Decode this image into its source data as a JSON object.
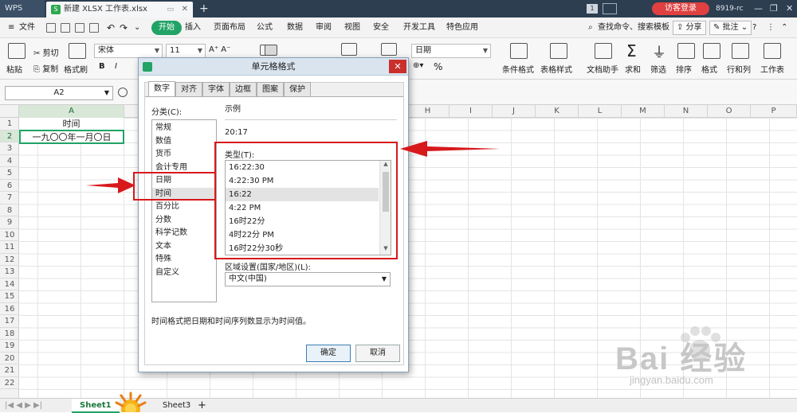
{
  "titlebar": {
    "app": "WPS",
    "file_tab": "新建 XLSX 工作表.xlsx",
    "new_tab": "+",
    "badge": "1",
    "login": "访客登录",
    "user": "8919-rc"
  },
  "menubar": {
    "file": "文件",
    "start": "开始",
    "items": [
      "插入",
      "页面布局",
      "公式",
      "数据",
      "审阅",
      "视图",
      "安全",
      "开发工具",
      "特色应用"
    ],
    "search": "查找命令、搜索模板",
    "share": "分享",
    "comment": "批注"
  },
  "toolbar": {
    "paste": "粘贴",
    "cut": "剪切",
    "copy": "复制",
    "format_painter": "格式刷",
    "font": "宋体",
    "size": "11",
    "bold": "B",
    "italic": "I",
    "number_format": "日期",
    "percent": "%",
    "cond_format": "条件格式",
    "table_style": "表格样式",
    "doc_helper": "文档助手",
    "sum": "求和",
    "filter": "筛选",
    "sort": "排序",
    "format": "格式",
    "rowcol": "行和列",
    "worksheet": "工作表"
  },
  "formula": {
    "namebox": "A2"
  },
  "columns": [
    "A",
    "H",
    "I",
    "J",
    "K",
    "L",
    "M",
    "N",
    "O",
    "P"
  ],
  "rows": [
    "1",
    "2",
    "3",
    "4",
    "5",
    "6",
    "7",
    "8",
    "9",
    "10",
    "11",
    "12",
    "13",
    "14",
    "15",
    "16",
    "17",
    "18",
    "19",
    "20",
    "21",
    "22"
  ],
  "cells": {
    "a1": "时间",
    "a2": "一九〇〇年一月〇日"
  },
  "sheets": {
    "active": "Sheet1",
    "other": "Sheet3",
    "add": "+"
  },
  "dialog": {
    "title": "单元格格式",
    "tabs": [
      "数字",
      "对齐",
      "字体",
      "边框",
      "图案",
      "保护"
    ],
    "category_label": "分类(C):",
    "categories": [
      "常规",
      "数值",
      "货币",
      "会计专用",
      "日期",
      "时间",
      "百分比",
      "分数",
      "科学记数",
      "文本",
      "特殊",
      "自定义"
    ],
    "selected_category": "时间",
    "sample_label": "示例",
    "sample_value": "20:17",
    "type_label": "类型(T):",
    "types": [
      "16:22:30",
      "4:22:30 PM",
      "16:22",
      "4:22 PM",
      "16时22分",
      "4时22分 PM",
      "16时22分30秒"
    ],
    "selected_type": "16:22",
    "locale_label": "区域设置(国家/地区)(L):",
    "locale_value": "中文(中国)",
    "description": "时间格式把日期和时间序列数显示为时间值。",
    "ok": "确定",
    "cancel": "取消"
  },
  "watermark": {
    "brand": "Bai 经验",
    "url": "jingyan.baidu.com"
  },
  "colors": {
    "accent": "#21a366",
    "annotation": "#d7191c",
    "titlebar": "#2d3e50"
  }
}
